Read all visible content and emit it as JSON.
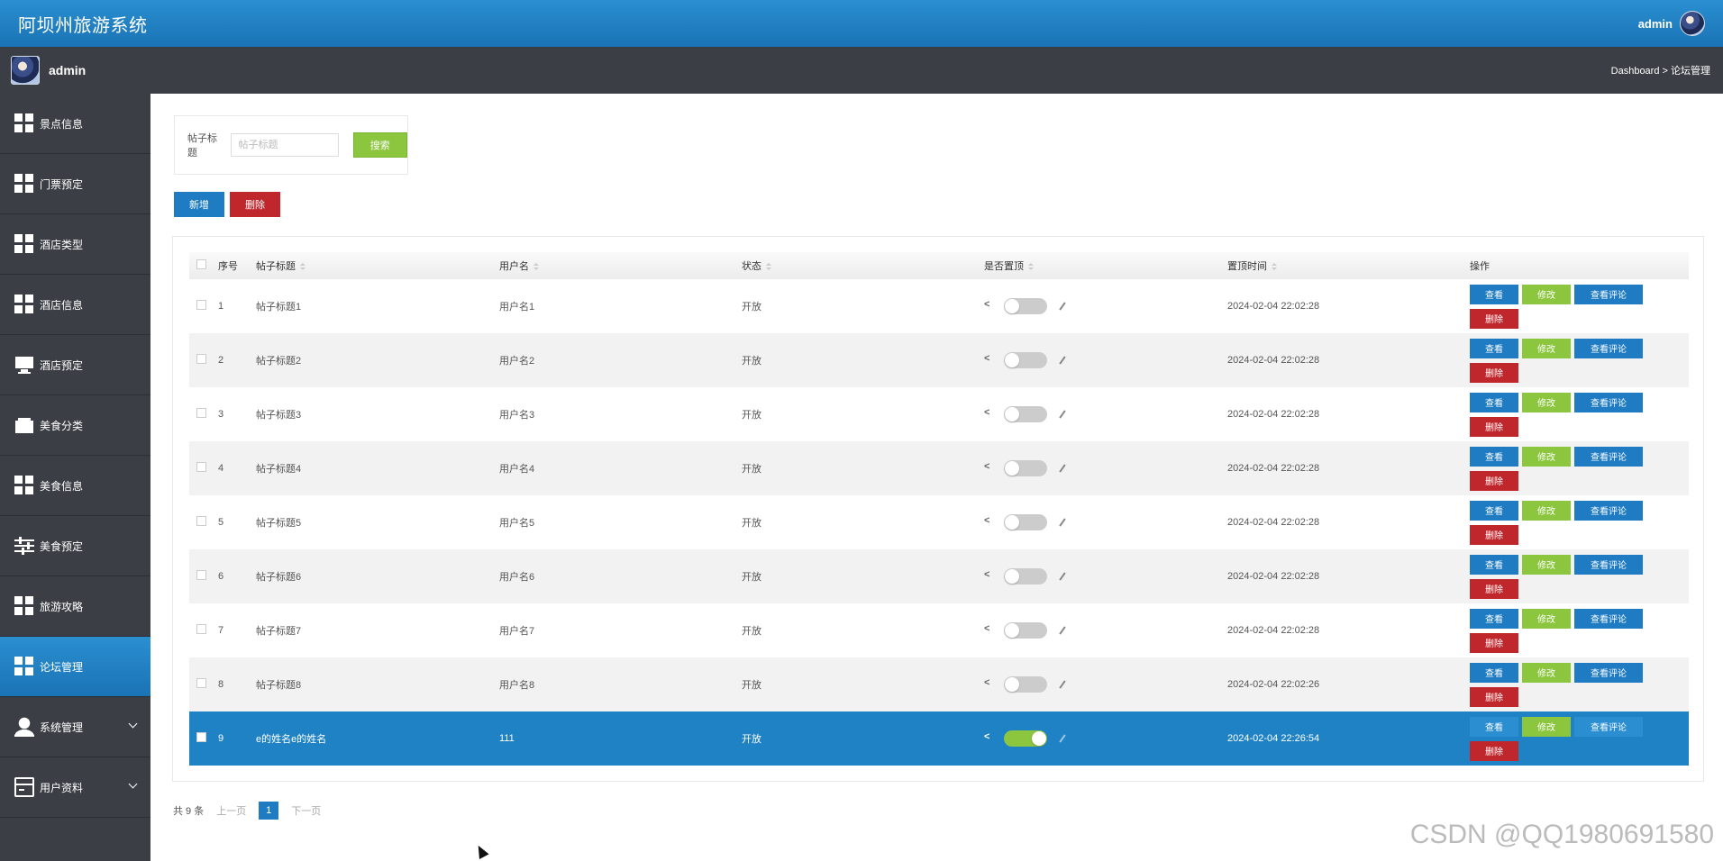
{
  "app": {
    "title": "阿坝州旅游系统",
    "user": "admin"
  },
  "sidebar": {
    "user": "admin",
    "items": [
      {
        "label": "景点信息",
        "icon": "grid-icon"
      },
      {
        "label": "门票预定",
        "icon": "grid-icon"
      },
      {
        "label": "酒店类型",
        "icon": "grid-icon"
      },
      {
        "label": "酒店信息",
        "icon": "grid-icon"
      },
      {
        "label": "酒店预定",
        "icon": "monitor-icon"
      },
      {
        "label": "美食分类",
        "icon": "wallet-icon"
      },
      {
        "label": "美食信息",
        "icon": "grid-icon"
      },
      {
        "label": "美食预定",
        "icon": "sliders-icon"
      },
      {
        "label": "旅游攻略",
        "icon": "grid-icon"
      },
      {
        "label": "论坛管理",
        "icon": "grid-icon",
        "active": true
      },
      {
        "label": "系统管理",
        "icon": "person-icon",
        "expandable": true
      },
      {
        "label": "用户资料",
        "icon": "card-icon",
        "expandable": true
      }
    ]
  },
  "breadcrumb": "Dashboard > 论坛管理",
  "search": {
    "label": "帖子标题",
    "placeholder": "帖子标题",
    "button": "搜索"
  },
  "actions": {
    "add": "新增",
    "delete": "删除"
  },
  "table": {
    "headers": [
      "序号",
      "帖子标题",
      "用户名",
      "状态",
      "是否置顶",
      "置顶时间",
      "操作"
    ],
    "ops": {
      "view": "查看",
      "edit": "修改",
      "comments": "查看评论",
      "delete": "删除"
    },
    "rows": [
      {
        "idx": "1",
        "title": "帖子标题1",
        "user": "用户名1",
        "status": "开放",
        "pinned": false,
        "time": "2024-02-04 22:02:28"
      },
      {
        "idx": "2",
        "title": "帖子标题2",
        "user": "用户名2",
        "status": "开放",
        "pinned": false,
        "time": "2024-02-04 22:02:28"
      },
      {
        "idx": "3",
        "title": "帖子标题3",
        "user": "用户名3",
        "status": "开放",
        "pinned": false,
        "time": "2024-02-04 22:02:28"
      },
      {
        "idx": "4",
        "title": "帖子标题4",
        "user": "用户名4",
        "status": "开放",
        "pinned": false,
        "time": "2024-02-04 22:02:28"
      },
      {
        "idx": "5",
        "title": "帖子标题5",
        "user": "用户名5",
        "status": "开放",
        "pinned": false,
        "time": "2024-02-04 22:02:28"
      },
      {
        "idx": "6",
        "title": "帖子标题6",
        "user": "用户名6",
        "status": "开放",
        "pinned": false,
        "time": "2024-02-04 22:02:28"
      },
      {
        "idx": "7",
        "title": "帖子标题7",
        "user": "用户名7",
        "status": "开放",
        "pinned": false,
        "time": "2024-02-04 22:02:28"
      },
      {
        "idx": "8",
        "title": "帖子标题8",
        "user": "用户名8",
        "status": "开放",
        "pinned": false,
        "time": "2024-02-04 22:02:26"
      },
      {
        "idx": "9",
        "title": "e的姓名e的姓名",
        "user": "111",
        "status": "开放",
        "pinned": true,
        "time": "2024-02-04 22:26:54",
        "selected": true
      }
    ]
  },
  "pager": {
    "total": "共 9 条",
    "prev": "上一页",
    "current": "1",
    "next": "下一页"
  },
  "watermark": "CSDN @QQ1980691580"
}
